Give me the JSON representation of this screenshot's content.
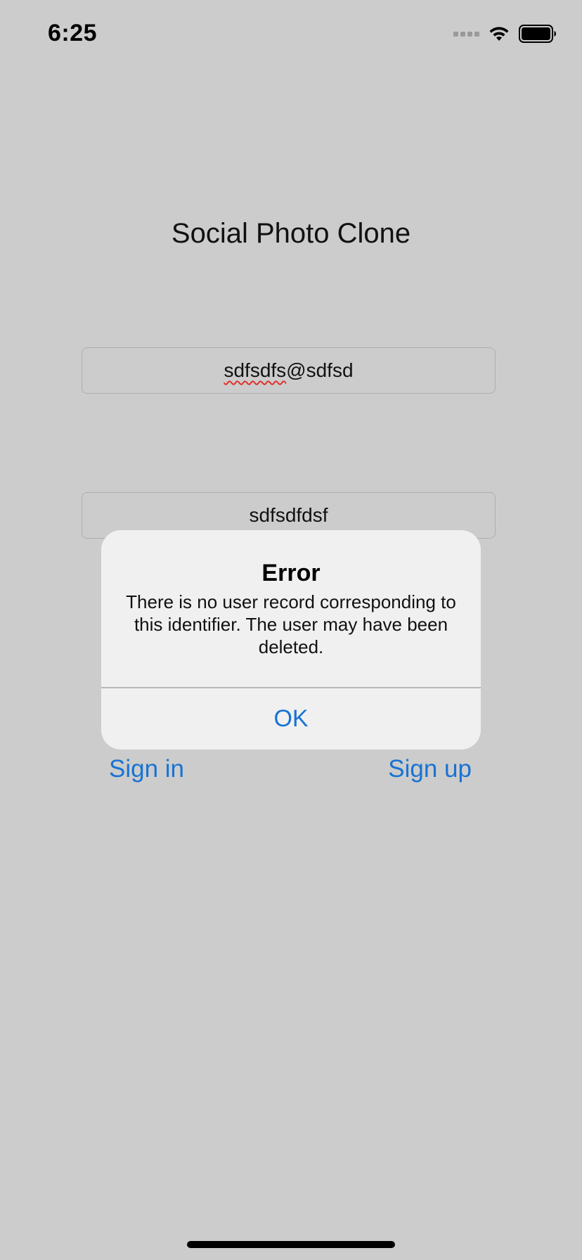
{
  "status_bar": {
    "time": "6:25",
    "icons": [
      "cellular-signal-icon",
      "wifi-icon",
      "battery-icon"
    ]
  },
  "app": {
    "title": "Social Photo Clone"
  },
  "form": {
    "email": {
      "value_part1": "sdfsdfs",
      "value_part2": "@sdfsd"
    },
    "password": {
      "value": "sdfsdfdsf"
    },
    "signin_label": "Sign in",
    "signup_label": "Sign up"
  },
  "alert": {
    "title": "Error",
    "message": "There is no user record corresponding to this identifier. The user may have been deleted.",
    "ok_label": "OK"
  },
  "colors": {
    "background": "#cccccc",
    "accent": "#1873d3",
    "alert_background": "#f0f0f0",
    "spellcheck": "#e0322d"
  }
}
